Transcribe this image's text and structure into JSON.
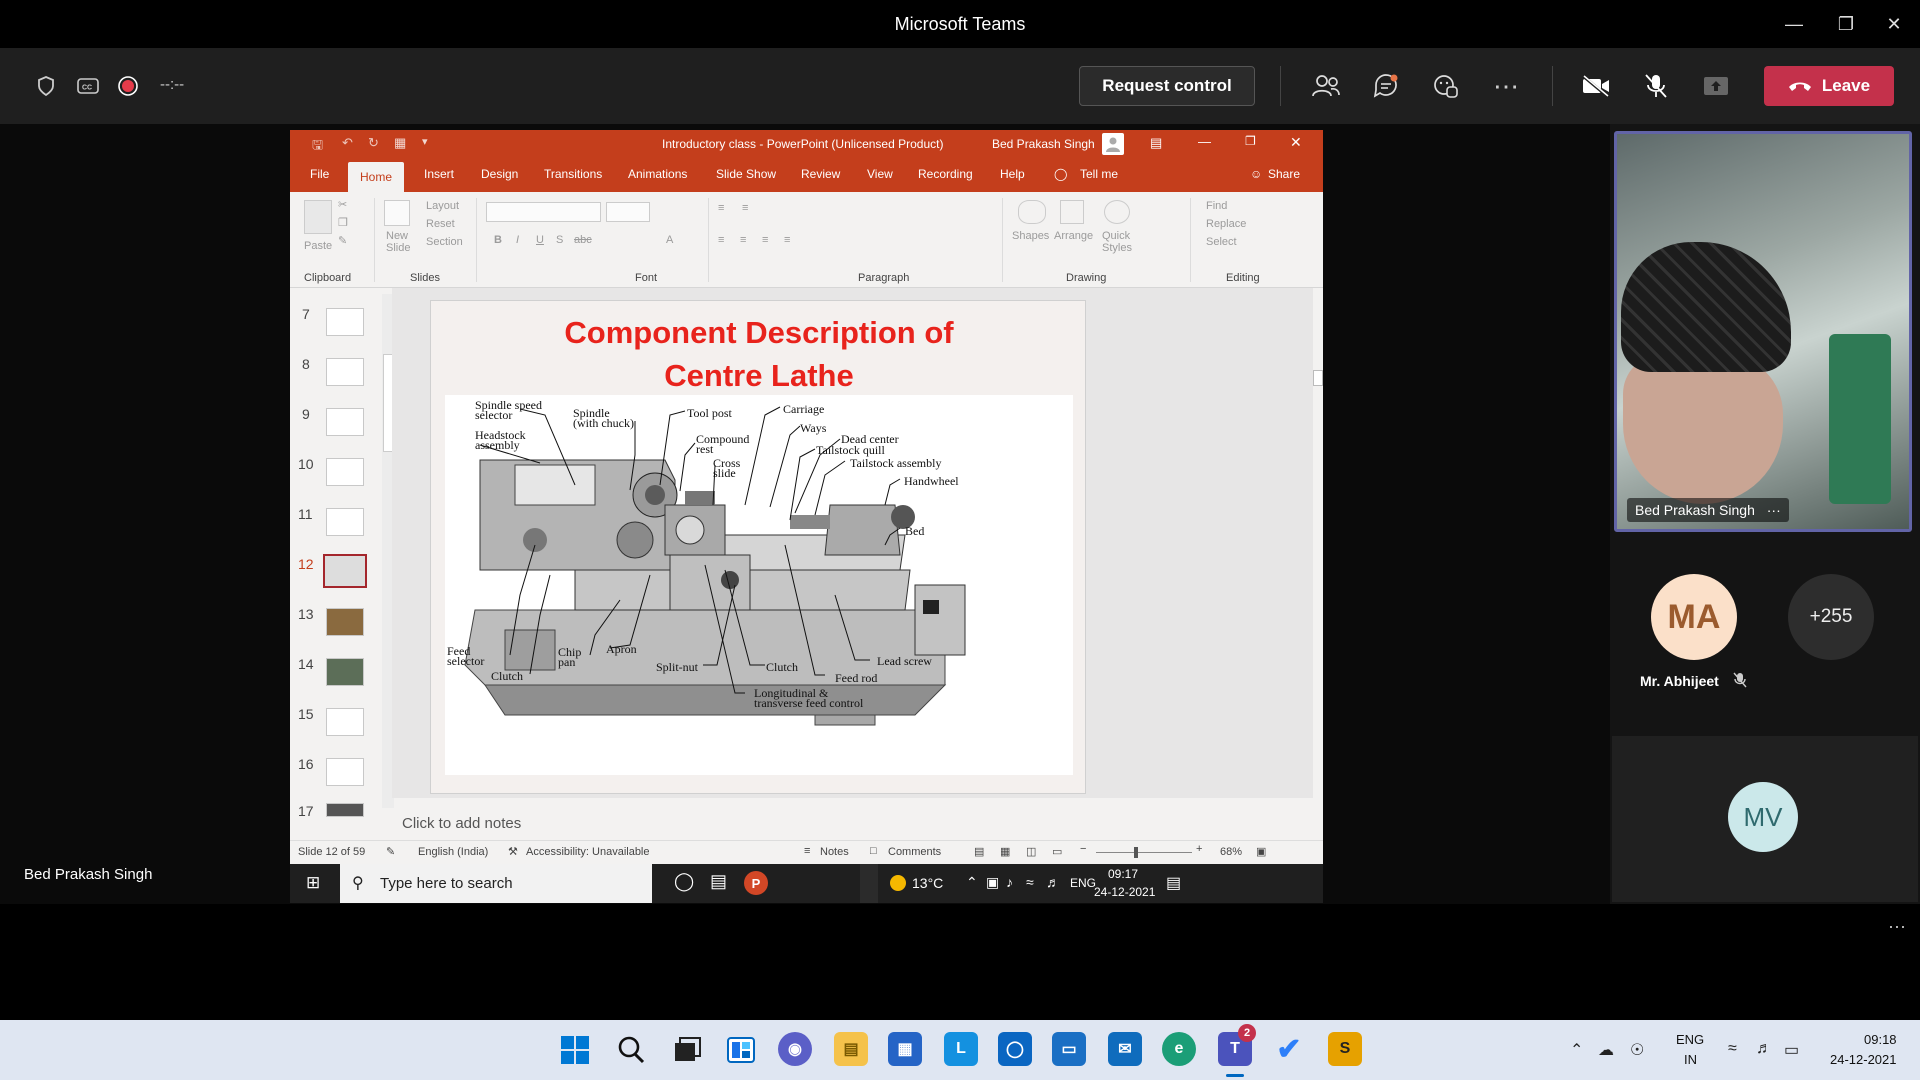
{
  "teams": {
    "window_title": "Microsoft Teams",
    "timer": "--:--",
    "request_control": "Request control",
    "leave": "Leave",
    "stage_name": "Bed Prakash Singh",
    "camera_name": "Bed Prakash Singh",
    "camera_more": "···",
    "participants": [
      {
        "initials": "MA",
        "name": "Mr. Abhijeet"
      },
      {
        "initials": "+255"
      },
      {
        "initials": "MV"
      }
    ],
    "more_label": "···",
    "leave_color": "#c4314b",
    "accent_color": "#6264a7"
  },
  "powerpoint": {
    "title": "Introductory class  -  PowerPoint (Unlicensed Product)",
    "user": "Bed Prakash Singh",
    "tabs": [
      "File",
      "Home",
      "Insert",
      "Design",
      "Transitions",
      "Animations",
      "Slide Show",
      "Review",
      "View",
      "Recording",
      "Help",
      "Tell me"
    ],
    "share": "Share",
    "ribbon": {
      "paste": "Paste",
      "new_slide": "New Slide",
      "layout": "Layout",
      "reset": "Reset",
      "section": "Section",
      "shapes": "Shapes",
      "arrange": "Arrange",
      "quick_styles": "Quick Styles",
      "find": "Find",
      "replace": "Replace",
      "select": "Select",
      "groups": [
        "Clipboard",
        "Slides",
        "Font",
        "Paragraph",
        "Drawing",
        "Editing"
      ]
    },
    "slide_numbers": [
      "7",
      "8",
      "9",
      "10",
      "11",
      "12",
      "13",
      "14",
      "15",
      "16",
      "17"
    ],
    "current_slide": "12",
    "slide": {
      "title_line1": "Component Description of",
      "title_line2": "Centre Lathe",
      "labels": {
        "spindle_speed": "Spindle speed",
        "selector": "selector",
        "spindle": "Spindle",
        "with_chuck": "(with chuck)",
        "headstock": "Headstock",
        "assembly": "assembly",
        "tool_post": "Tool post",
        "compound": "Compound",
        "rest": "rest",
        "cross": "Cross",
        "slide": "slide",
        "carriage": "Carriage",
        "ways": "Ways",
        "dead_center": "Dead center",
        "tailstock_quill": "Tailstock quill",
        "tailstock_assembly": "Tailstock assembly",
        "handwheel": "Handwheel",
        "bed": "Bed",
        "feed": "Feed",
        "feed_selector": "selector",
        "chip": "Chip",
        "pan": "pan",
        "apron": "Apron",
        "clutch1": "Clutch",
        "split_nut": "Split-nut",
        "clutch2": "Clutch",
        "lead_screw": "Lead screw",
        "feed_rod": "Feed rod",
        "longitudinal": "Longitudinal &",
        "transverse": "transverse feed control"
      }
    },
    "notes_placeholder": "Click to add notes",
    "status": {
      "slide_of": "Slide 12 of 59",
      "language": "English (India)",
      "accessibility": "Accessibility: Unavailable",
      "notes": "Notes",
      "comments": "Comments",
      "zoom": "68%"
    }
  },
  "inner_taskbar": {
    "search_placeholder": "Type here to search",
    "temp": "13°C",
    "lang": "ENG",
    "time": "09:17",
    "date": "24-12-2021"
  },
  "taskbar": {
    "lang1": "ENG",
    "lang2": "IN",
    "time": "09:18",
    "date": "24-12-2021",
    "teams_badge": "2"
  }
}
